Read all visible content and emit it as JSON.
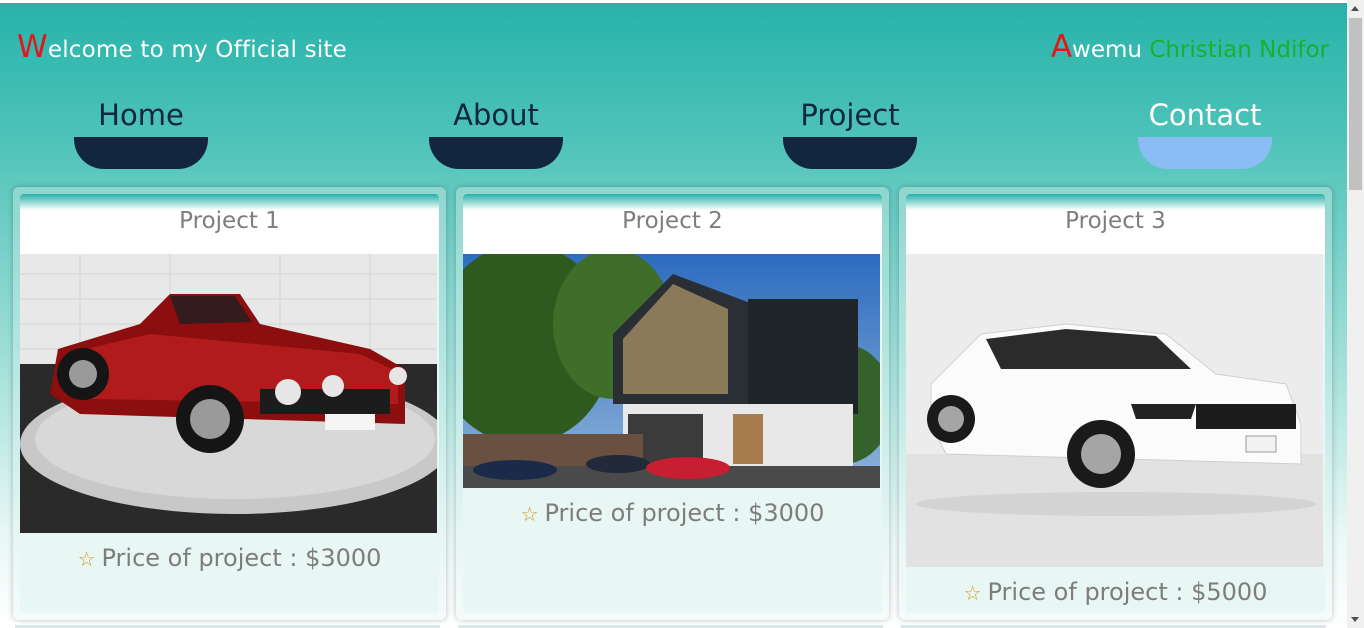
{
  "header": {
    "welcome_cap": "W",
    "welcome_rest": "elcome to my Official site",
    "author_cap": "A",
    "author_rest": "wemu",
    "author_name": "Christian Ndifor"
  },
  "nav": {
    "items": [
      {
        "label": "Home",
        "active": false
      },
      {
        "label": "About",
        "active": false
      },
      {
        "label": "Project",
        "active": false
      },
      {
        "label": "Contact",
        "active": true
      }
    ]
  },
  "projects": [
    {
      "title": "Project 1",
      "image": "red-convertible-car-photo",
      "price": "Price of project : $3000"
    },
    {
      "title": "Project 2",
      "image": "modern-house-photo",
      "price": "Price of project : $3000"
    },
    {
      "title": "Project 3",
      "image": "white-sedan-car-photo",
      "price": "Price of project : $5000"
    }
  ],
  "icons": {
    "star": "☆"
  },
  "colors": {
    "accent_red": "#e8141b",
    "accent_green": "#19b02f",
    "nav_dark": "#12263f",
    "nav_active": "#8bbdf4",
    "teal": "#26b3aa"
  }
}
